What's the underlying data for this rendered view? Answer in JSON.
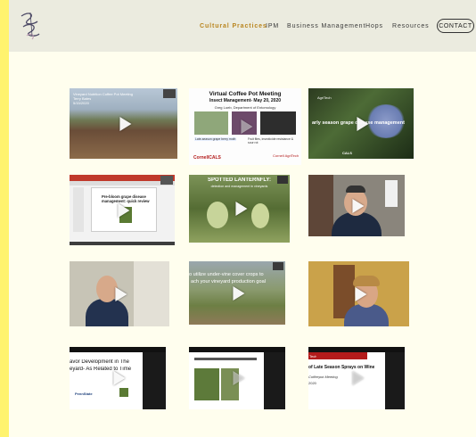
{
  "nav": {
    "items": [
      {
        "label": "Cultural Practices",
        "active": true
      },
      {
        "label": "IPM",
        "active": false
      },
      {
        "label": "Business Management",
        "active": false
      },
      {
        "label": "Hops",
        "active": false
      },
      {
        "label": "Resources",
        "active": false
      }
    ],
    "contact_label": "CONTACT"
  },
  "videos": [
    {
      "icon": "play-icon",
      "lines": [
        "Vineyard Nutrition Coffee Pot Meeting",
        "Terry Bates",
        "5/15/2020"
      ]
    },
    {
      "icon": "play-icon",
      "lines": [
        "Virtual Coffee Pot Meeting",
        "Insect Management- May 20, 2020",
        "Greg Loeb, Department of Entomology",
        "Late-season grape berry moth",
        "Fruit flies, insecticide resistance & sour rot",
        "CornellCALS",
        "Cornell AgriTech"
      ]
    },
    {
      "icon": "play-icon",
      "lines": [
        "AgriTech",
        "arly season grape disease management",
        "CALS"
      ]
    },
    {
      "icon": "play-icon",
      "lines": [
        "Pre-bloom grape disease",
        "management: quick review"
      ]
    },
    {
      "icon": "play-icon",
      "lines": [
        "SPOTTED LANTERNFLY:",
        "detection and management in vineyards"
      ]
    },
    {
      "icon": "play-icon",
      "lines": []
    },
    {
      "icon": "play-icon",
      "lines": []
    },
    {
      "icon": "play-icon",
      "lines": [
        "o utilize under-vine cover crops to",
        "ach your vineyard production goal"
      ]
    },
    {
      "icon": "play-icon",
      "lines": []
    },
    {
      "icon": "play-icon",
      "lines": [
        "avor Development in The",
        "eyard- As Related to Time",
        "PennState"
      ]
    },
    {
      "icon": "play-icon",
      "lines": []
    },
    {
      "icon": "play-icon",
      "lines": [
        "Tech",
        "of Late Season Sprays on Wine",
        "Coffeepot Meeting",
        "2020"
      ]
    }
  ],
  "colors": {
    "accent": "#b9851f",
    "page_bg": "#fffeee",
    "header_bg": "#ebebdf",
    "left_strip": "#fff36e"
  }
}
